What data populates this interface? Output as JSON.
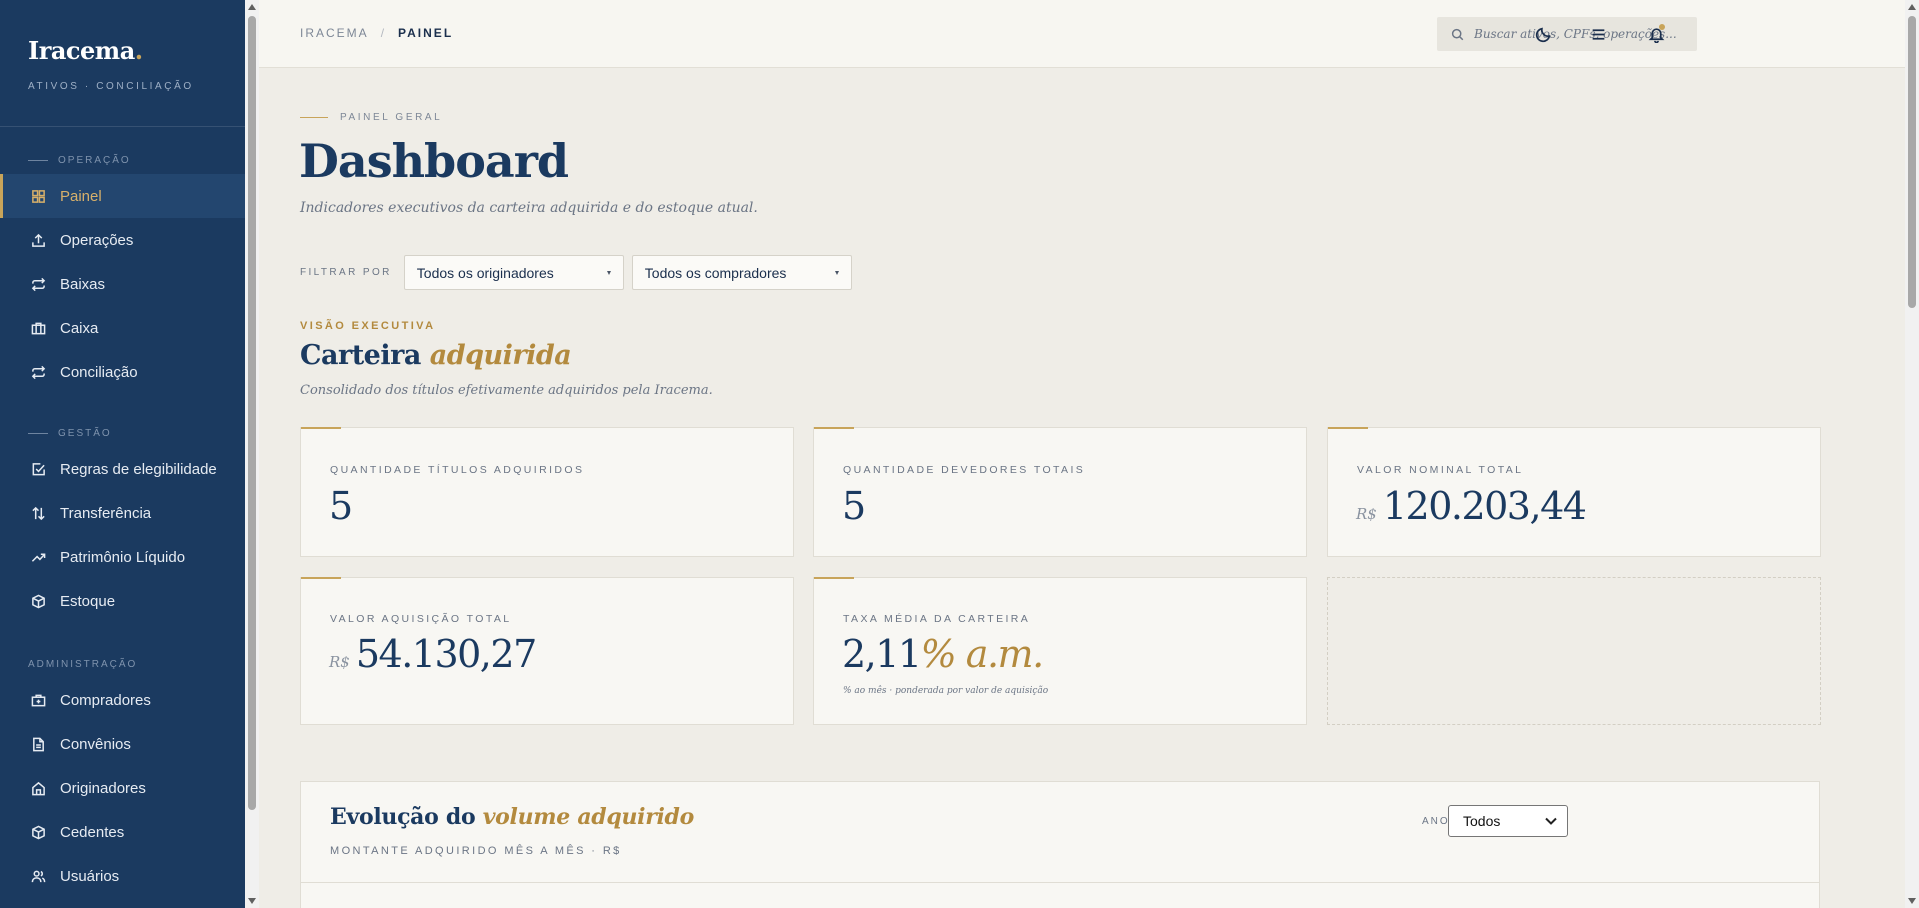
{
  "brand": {
    "name": "Iracema",
    "dot": ".",
    "subtitle": "ATIVOS · CONCILIAÇÃO"
  },
  "sidebar": {
    "sections": [
      {
        "label": "OPERAÇÃO",
        "items": [
          {
            "label": "Painel",
            "icon": "grid-icon",
            "active": true
          },
          {
            "label": "Operações",
            "icon": "upload-icon"
          },
          {
            "label": "Baixas",
            "icon": "repeat-icon"
          },
          {
            "label": "Caixa",
            "icon": "briefcase-icon"
          },
          {
            "label": "Conciliação",
            "icon": "repeat-icon"
          }
        ]
      },
      {
        "label": "GESTÃO",
        "items": [
          {
            "label": "Regras de elegibilidade",
            "icon": "check-square-icon"
          },
          {
            "label": "Transferência",
            "icon": "arrows-updown-icon"
          },
          {
            "label": "Patrimônio Líquido",
            "icon": "trending-up-icon"
          },
          {
            "label": "Estoque",
            "icon": "box-icon"
          }
        ]
      },
      {
        "label": "ADMINISTRAÇÃO",
        "items": [
          {
            "label": "Compradores",
            "icon": "briefcase-plus-icon"
          },
          {
            "label": "Convênios",
            "icon": "file-text-icon"
          },
          {
            "label": "Originadores",
            "icon": "home-icon"
          },
          {
            "label": "Cedentes",
            "icon": "box-icon"
          },
          {
            "label": "Usuários",
            "icon": "users-icon"
          }
        ]
      }
    ]
  },
  "topbar": {
    "breadcrumb": {
      "root": "IRACEMA",
      "separator": "/",
      "current": "PAINEL"
    },
    "search_placeholder": "Buscar ativos, CPFs, operações...",
    "icons": [
      "moon-icon",
      "menu-icon",
      "bell-icon"
    ]
  },
  "page": {
    "eyebrow": "PAINEL GERAL",
    "title": "Dashboard",
    "subtitle": "Indicadores executivos da carteira adquirida e do estoque atual.",
    "filter_label": "FILTRAR POR",
    "filter_originadores": "Todos os originadores",
    "filter_compradores": "Todos os compradores"
  },
  "section": {
    "eyebrow": "VISÃO EXECUTIVA",
    "title_main": "Carteira",
    "title_accent": "adquirida",
    "subtitle": "Consolidado dos títulos efetivamente adquiridos pela Iracema."
  },
  "kpis": {
    "titulos": {
      "label": "QUANTIDADE TÍTULOS ADQUIRIDOS",
      "value": "5"
    },
    "devedores": {
      "label": "QUANTIDADE DEVEDORES TOTAIS",
      "value": "5"
    },
    "nominal": {
      "label": "VALOR NOMINAL TOTAL",
      "currency": "R$",
      "value": "120.203,44"
    },
    "aquisicao": {
      "label": "VALOR AQUISIÇÃO TOTAL",
      "currency": "R$",
      "value": "54.130,27"
    },
    "taxa": {
      "label": "TAXA MÉDIA DA CARTEIRA",
      "value": "2,11",
      "unit": "% a.m.",
      "note": "% ao mês · ponderada por valor de aquisição"
    }
  },
  "chart": {
    "title_main": "Evolução do",
    "title_accent": "volume adquirido",
    "subtitle": "MONTANTE ADQUIRIDO MÊS A MÊS · R$",
    "year_label": "ANO",
    "year_value": "Todos"
  },
  "colors": {
    "sidebar": "#1b3a60",
    "accent": "#c8a45a",
    "background": "#efede7"
  }
}
